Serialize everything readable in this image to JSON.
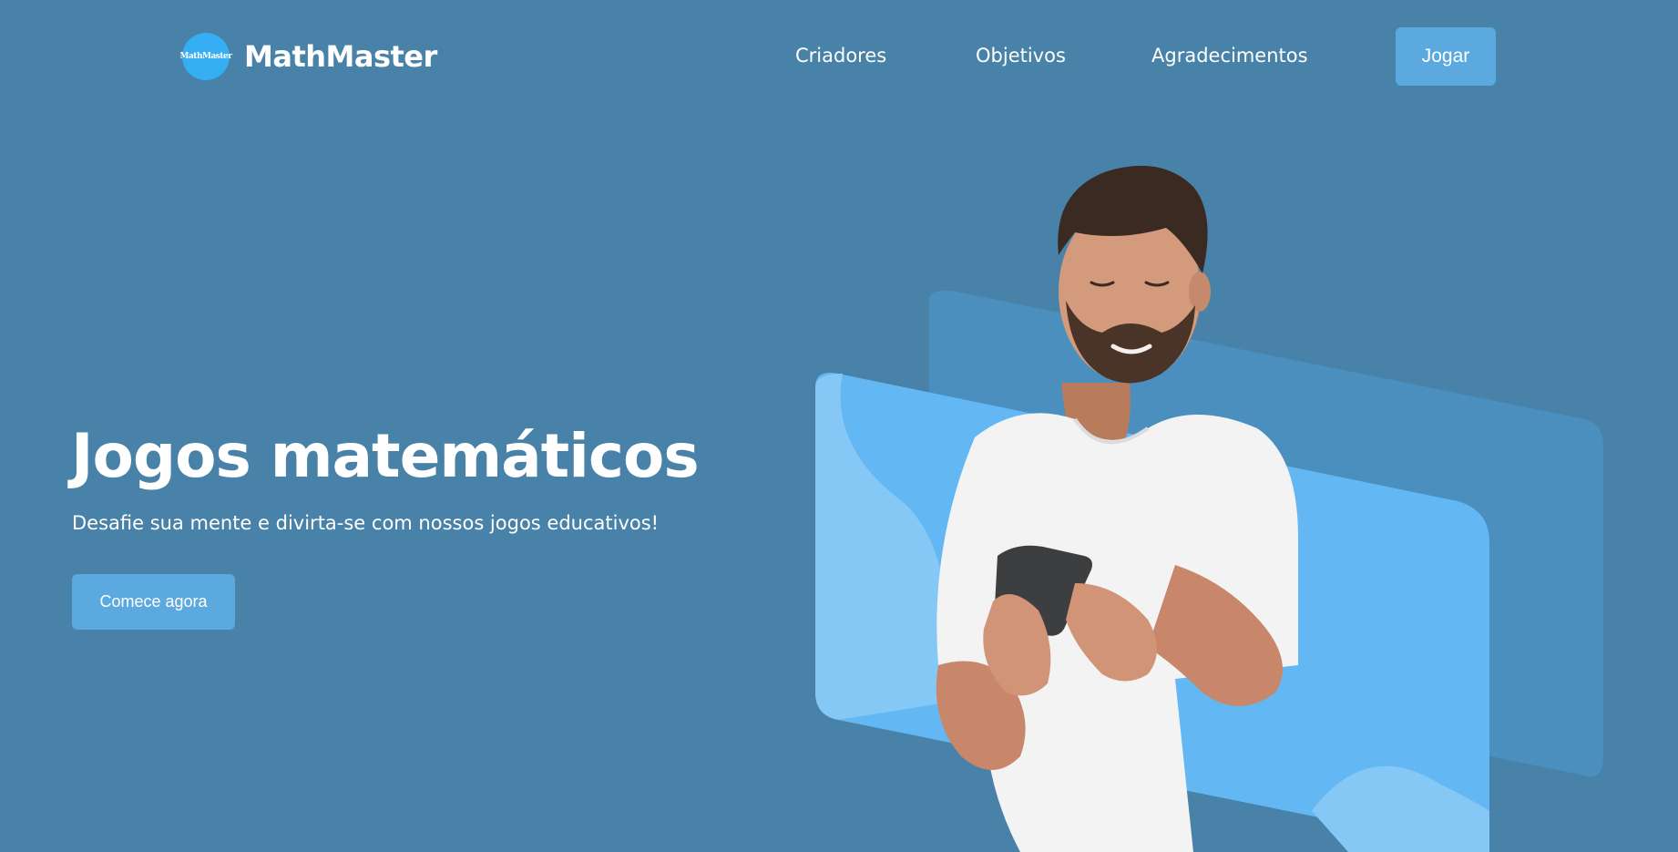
{
  "header": {
    "logo_badge_text": "MathMaster",
    "logo_text": "MathMaster",
    "nav": {
      "criadores": "Criadores",
      "objetivos": "Objetivos",
      "agradecimentos": "Agradecimentos"
    },
    "play_label": "Jogar"
  },
  "hero": {
    "title": "Jogos matemáticos",
    "subtitle": "Desafie sua mente e divirta-se com nossos jogos educativos!",
    "cta_label": "Comece agora",
    "image_alt": "man-smiling-holding-phone"
  },
  "colors": {
    "background": "#4882a8",
    "accent": "#5ba9df",
    "logo": "#35aef3",
    "card_back": "#4b8fbf",
    "card_front": "#63b8f3",
    "card_wave": "#85c8f5"
  }
}
